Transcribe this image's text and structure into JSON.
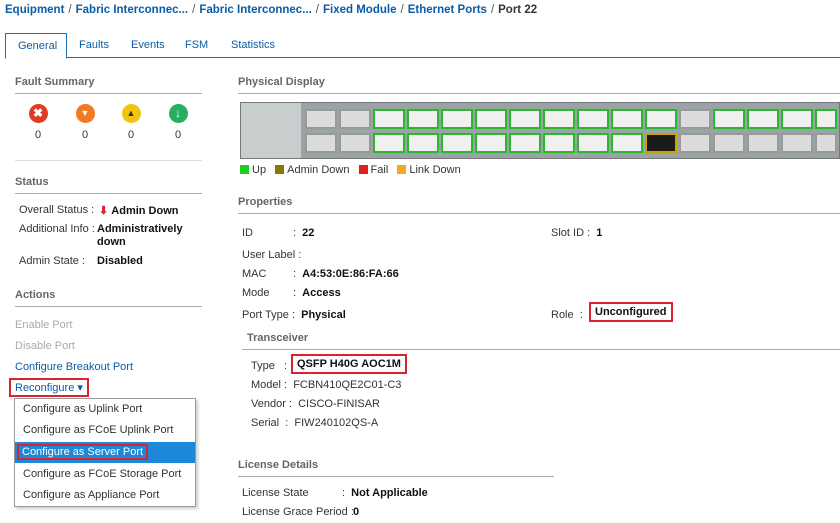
{
  "breadcrumb": [
    "Equipment",
    "Fabric Interconnec...",
    "Fabric Interconnec...",
    "Fixed Module",
    "Ethernet Ports"
  ],
  "breadcrumb_current": "Port 22",
  "tabs": [
    {
      "label": "General"
    },
    {
      "label": "Faults"
    },
    {
      "label": "Events"
    },
    {
      "label": "FSM"
    },
    {
      "label": "Statistics"
    }
  ],
  "fault_summary": {
    "title": "Fault Summary",
    "items": [
      {
        "icon": "critical-icon",
        "glyph": "✖",
        "count": "0"
      },
      {
        "icon": "major-icon",
        "glyph": "▼",
        "count": "0"
      },
      {
        "icon": "minor-icon",
        "glyph": "▲",
        "count": "0"
      },
      {
        "icon": "warning-icon",
        "glyph": "↓",
        "count": "0"
      }
    ]
  },
  "status": {
    "title": "Status",
    "overall_label": "Overall Status",
    "overall_value": "Admin Down",
    "additional_label": "Additional Info",
    "additional_value_1": "Administratively",
    "additional_value_2": "down",
    "admin_label": "Admin State",
    "admin_value": "Disabled"
  },
  "actions": {
    "title": "Actions",
    "enable": "Enable Port",
    "disable": "Disable Port",
    "breakout": "Configure Breakout Port",
    "reconfigure": "Reconfigure ▾",
    "menu": [
      "Configure as Uplink Port",
      "Configure as FCoE Uplink Port",
      "Configure as Server Port",
      "Configure as FCoE Storage Port",
      "Configure as Appliance Port"
    ]
  },
  "physical_display": {
    "title": "Physical Display",
    "legend": [
      {
        "label": "Up",
        "color": "#22cc22"
      },
      {
        "label": "Admin Down",
        "color": "#8a7a00"
      },
      {
        "label": "Fail",
        "color": "#e02020"
      },
      {
        "label": "Link Down",
        "color": "#f5a623"
      }
    ]
  },
  "properties": {
    "title": "Properties",
    "id_label": "ID",
    "id_value": "22",
    "slot_label": "Slot ID",
    "slot_value": "1",
    "user_label": "User Label",
    "mac_label": "MAC",
    "mac_value": "A4:53:0E:86:FA:66",
    "mode_label": "Mode",
    "mode_value": "Access",
    "port_type_label": "Port Type",
    "port_type_value": "Physical",
    "role_label": "Role",
    "role_value": "Unconfigured"
  },
  "transceiver": {
    "title": "Transceiver",
    "type_label": "Type",
    "type_value": "QSFP H40G AOC1M",
    "model_label": "Model",
    "model_value": "FCBN410QE2C01-C3",
    "vendor_label": "Vendor",
    "vendor_value": "CISCO-FINISAR",
    "serial_label": "Serial",
    "serial_value": "FIW240102QS-A"
  },
  "license": {
    "title": "License Details",
    "state_label": "License State",
    "state_value": "Not Applicable",
    "grace_label": "License Grace Period",
    "grace_value": "0"
  }
}
